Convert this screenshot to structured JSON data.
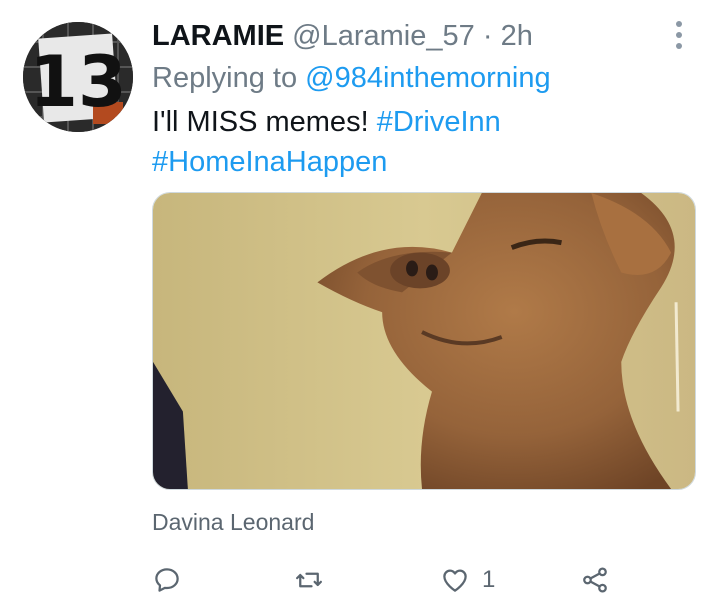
{
  "tweet": {
    "display_name": "LARAMIE",
    "handle": "@Laramie_57",
    "separator": "·",
    "time": "2h",
    "reply_prefix": "Replying to",
    "reply_to": "@984inthemorning",
    "text": "I'll MISS memes!",
    "hashtags": [
      "#DriveInn",
      "#HomeInaHappen"
    ],
    "media_alt_icon": "squinting-chihuahua-photo",
    "via_label": "Davina Leonard",
    "likes_count": "1"
  },
  "avatar": {
    "text": "13",
    "icon": "jersey-number-avatar"
  },
  "colors": {
    "accent": "#1d9bf0",
    "text": "#0f1419",
    "muted": "#6e7b86"
  },
  "icons": {
    "more": "more-vertical-icon",
    "reply": "reply-icon",
    "retweet": "retweet-icon",
    "like": "heart-icon",
    "share": "share-icon"
  }
}
